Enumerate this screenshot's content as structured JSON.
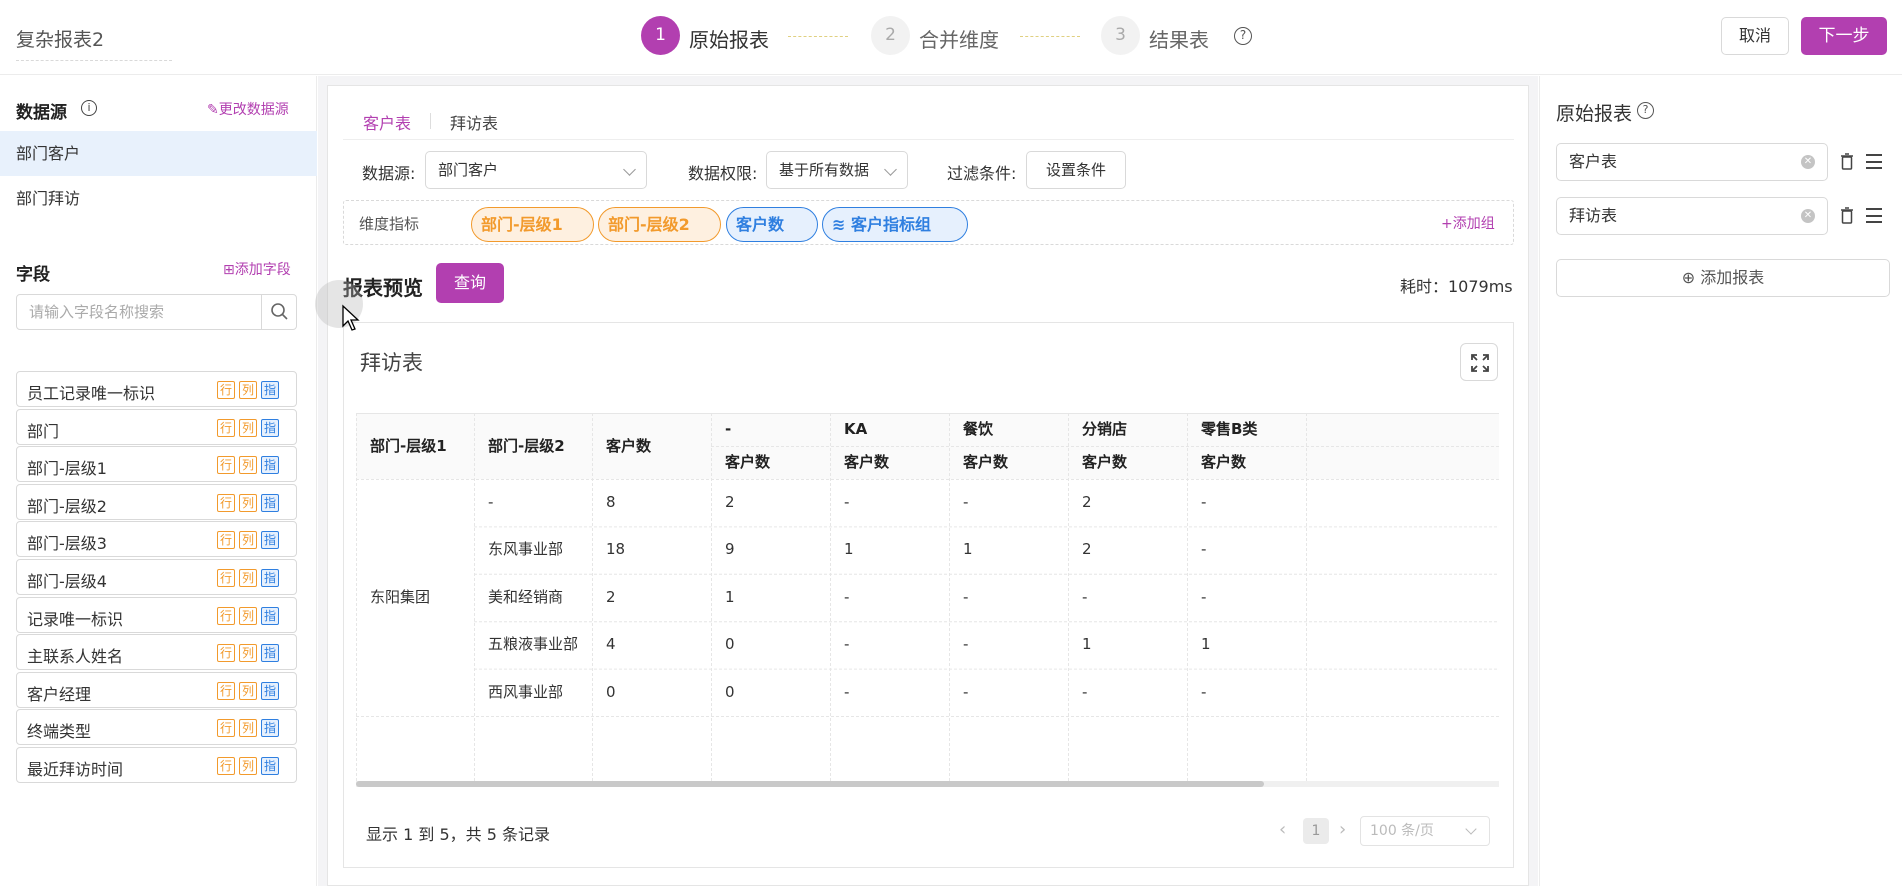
{
  "header": {
    "title": "复杂报表2",
    "steps": [
      {
        "num": "1",
        "label": "原始报表"
      },
      {
        "num": "2",
        "label": "合并维度"
      },
      {
        "num": "3",
        "label": "结果表"
      }
    ],
    "help": "?",
    "cancel_label": "取消",
    "next_label": "下一步"
  },
  "left": {
    "datasource_title": "数据源",
    "info": "i",
    "change_datasource": "更改数据源",
    "datasources": [
      "部门客户",
      "部门拜访"
    ],
    "fields_title": "字段",
    "add_field": "添加字段",
    "search_placeholder": "请输入字段名称搜索",
    "tag_row": "行",
    "tag_col": "列",
    "tag_ind": "指",
    "fields": [
      "员工记录唯一标识",
      "部门",
      "部门-层级1",
      "部门-层级2",
      "部门-层级3",
      "部门-层级4",
      "记录唯一标识",
      "主联系人姓名",
      "客户经理",
      "终端类型",
      "最近拜访时间"
    ]
  },
  "main": {
    "tabs": [
      "客户表",
      "拜访表"
    ],
    "datasource_label": "数据源:",
    "datasource_value": "部门客户",
    "permission_label": "数据权限:",
    "permission_value": "基于所有数据",
    "filter_label": "过滤条件:",
    "filter_button": "设置条件",
    "dim_label": "维度指标",
    "pills": [
      "部门-层级1",
      "部门-层级2",
      "客户数",
      "客户指标组"
    ],
    "add_group": "添加组",
    "preview_title": "报表预览",
    "query_label": "查询",
    "elapsed": "耗时：1079ms",
    "table_title": "拜访表",
    "table": {
      "head_fixed": [
        "部门-层级1",
        "部门-层级2",
        "客户数"
      ],
      "head_groups": [
        "-",
        "KA",
        "餐饮",
        "分销店",
        "零售B类"
      ],
      "sub_label": "客户数",
      "group_cell": "东阳集团",
      "rows": [
        [
          "-",
          "8",
          "2",
          "-",
          "-",
          "2",
          "-"
        ],
        [
          "东风事业部",
          "18",
          "9",
          "1",
          "1",
          "2",
          "-"
        ],
        [
          "美和经销商",
          "2",
          "1",
          "-",
          "-",
          "-",
          "-"
        ],
        [
          "五粮液事业部",
          "4",
          "0",
          "-",
          "-",
          "1",
          "1"
        ],
        [
          "西风事业部",
          "0",
          "0",
          "-",
          "-",
          "-",
          "-"
        ]
      ]
    },
    "pager_summary": "显示 1 到 5，共 5 条记录",
    "pager_page": "1",
    "pager_size": "100 条/页"
  },
  "right": {
    "title": "原始报表",
    "help": "?",
    "tables": [
      "客户表",
      "拜访表"
    ],
    "add_report": "添加报表"
  },
  "colors": {
    "accent": "#b23fb0",
    "orange": "#f29a2c",
    "blue": "#2f7fe0",
    "active_bg": "#e8f1fc"
  }
}
